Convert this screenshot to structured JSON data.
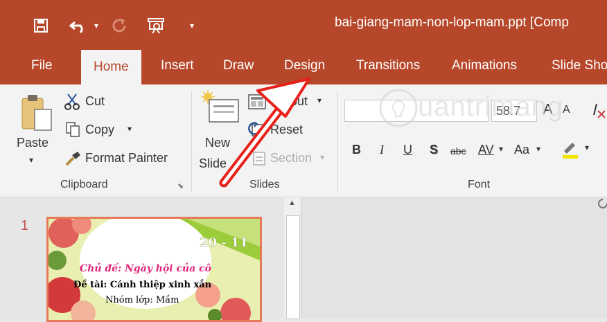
{
  "window": {
    "title": "bai-giang-mam-non-lop-mam.ppt [Comp"
  },
  "qat": {
    "customize": "▾"
  },
  "tabs": [
    "File",
    "Home",
    "Insert",
    "Draw",
    "Design",
    "Transitions",
    "Animations",
    "Slide Sho"
  ],
  "clipboard": {
    "paste": "Paste",
    "cut": "Cut",
    "copy": "Copy",
    "format_painter": "Format Painter",
    "group": "Clipboard"
  },
  "slides": {
    "new_slide_1": "New",
    "new_slide_2": "Slide",
    "layout": "Layout",
    "reset": "Reset",
    "section": "Section",
    "group": "Slides"
  },
  "font": {
    "size": "58.7",
    "bold": "B",
    "italic": "I",
    "underline": "U",
    "shadow": "S",
    "strike": "abc",
    "spacing": "AV",
    "change_case": "Aa",
    "grow": "A",
    "shrink": "A",
    "group": "Font"
  },
  "thumbnail": {
    "number": "1",
    "date": "20 - 11",
    "line1": "Chủ đề: Ngày hội của cô",
    "line2": "Đề tài: Cánh thiệp xinh xắn",
    "line3": "Nhóm lớp: Mầm"
  },
  "colors": {
    "accent": "#b7472a",
    "arrow": "#e8201a"
  },
  "watermark": {
    "text": "uantrimang"
  }
}
